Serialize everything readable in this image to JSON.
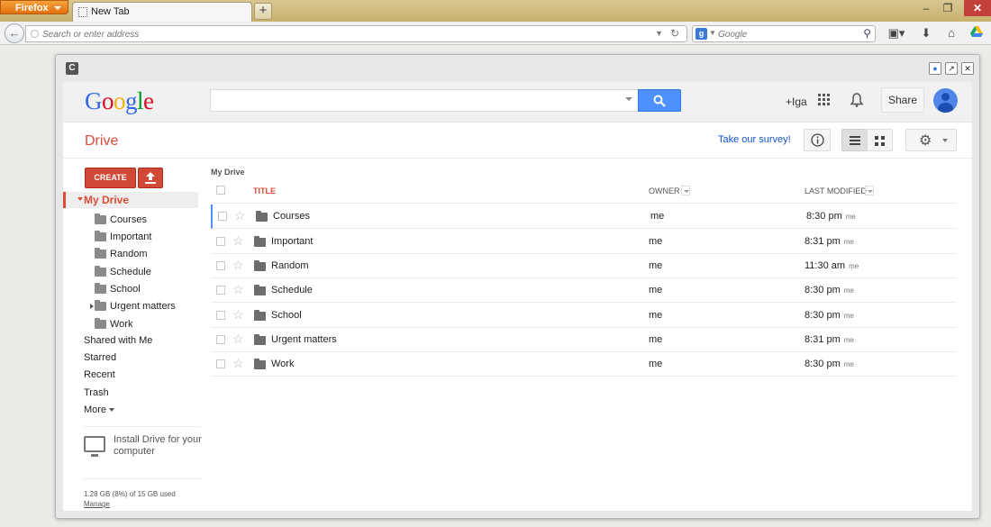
{
  "browser": {
    "menu_button": "Firefox",
    "tab_title": "New Tab",
    "new_tab_label": "+",
    "url_placeholder": "Search or enter address",
    "search_placeholder": "Google",
    "search_engine_letter": "g"
  },
  "google": {
    "logo": [
      "G",
      "o",
      "o",
      "g",
      "l",
      "e"
    ],
    "plus_user": "+Iga",
    "share_label": "Share"
  },
  "drive": {
    "title": "Drive",
    "survey_link": "Take our survey!",
    "create_label": "CREATE",
    "breadcrumb": "My Drive",
    "sidebar": {
      "my_drive": "My Drive",
      "folders": [
        "Courses",
        "Important",
        "Random",
        "Schedule",
        "School",
        "Urgent matters",
        "Work"
      ],
      "shared": "Shared with Me",
      "starred": "Starred",
      "recent": "Recent",
      "trash": "Trash",
      "more": "More",
      "install_text": "Install Drive for your computer",
      "quota": "1.28 GB (8%) of 15 GB used",
      "manage": "Manage"
    },
    "columns": {
      "title": "TITLE",
      "owner": "OWNER",
      "last_modified": "LAST MODIFIED"
    },
    "rows": [
      {
        "title": "Courses",
        "owner": "me",
        "time": "8:30 pm",
        "by": "me"
      },
      {
        "title": "Important",
        "owner": "me",
        "time": "8:31 pm",
        "by": "me"
      },
      {
        "title": "Random",
        "owner": "me",
        "time": "11:30 am",
        "by": "me"
      },
      {
        "title": "Schedule",
        "owner": "me",
        "time": "8:30 pm",
        "by": "me"
      },
      {
        "title": "School",
        "owner": "me",
        "time": "8:30 pm",
        "by": "me"
      },
      {
        "title": "Urgent matters",
        "owner": "me",
        "time": "8:31 pm",
        "by": "me"
      },
      {
        "title": "Work",
        "owner": "me",
        "time": "8:30 pm",
        "by": "me"
      }
    ]
  },
  "colors": {
    "drive_red": "#dd4b39",
    "google_blue": "#4d90fe",
    "link_blue": "#1155cc"
  }
}
